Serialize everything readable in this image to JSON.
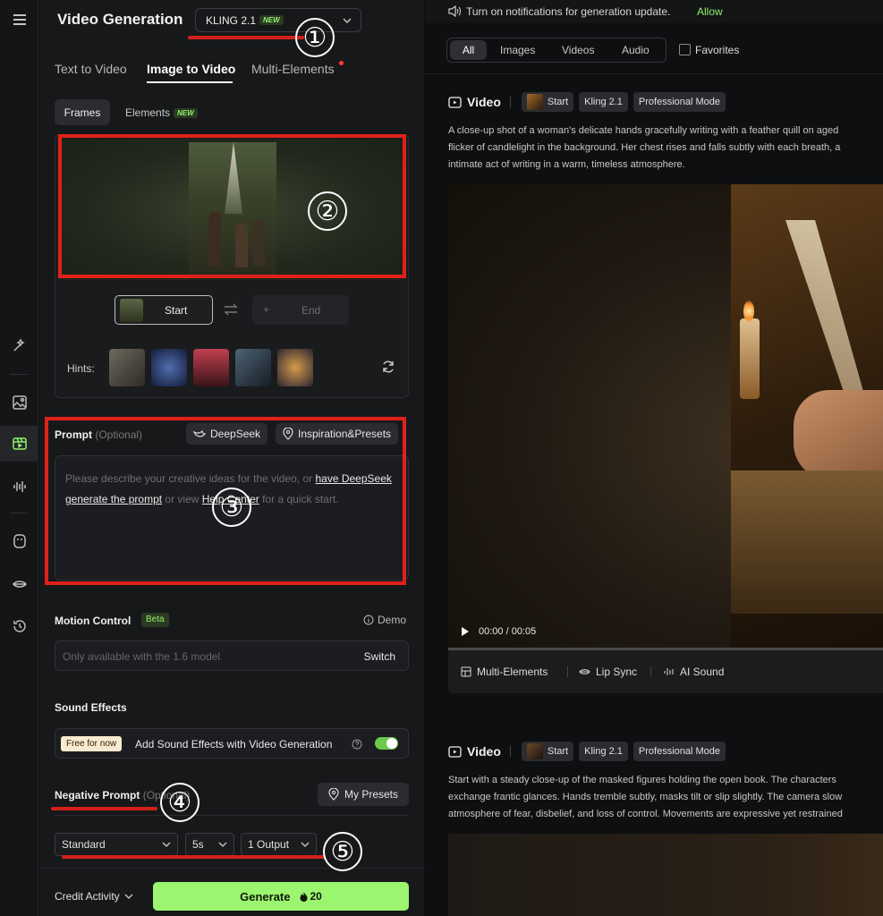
{
  "rail": {
    "icons": [
      "magic-icon",
      "image-icon",
      "video-icon",
      "audio-icon",
      "avatar-icon",
      "lip-icon",
      "history-icon"
    ]
  },
  "header": {
    "title": "Video Generation",
    "model": "KLING 2.1",
    "model_badge": "NEW"
  },
  "tabs": [
    {
      "label": "Text to Video"
    },
    {
      "label": "Image to Video"
    },
    {
      "label": "Multi-Elements"
    }
  ],
  "subtabs": {
    "frames": "Frames",
    "elements": "Elements",
    "elements_badge": "NEW"
  },
  "frames": {
    "start": "Start",
    "end": "End",
    "end_plus": "+"
  },
  "hints": {
    "label": "Hints:"
  },
  "prompt": {
    "label": "Prompt",
    "optional": "(Optional)",
    "deepseek": "DeepSeek",
    "inspiration": "Inspiration&Presets",
    "ph_1": "Please describe your creative ideas for the video, or ",
    "ph_link1": "have DeepSeek generate the prompt",
    "ph_2": " or view ",
    "ph_link2": "Help Center",
    "ph_3": " for a quick start."
  },
  "motion": {
    "label": "Motion Control",
    "badge": "Beta",
    "demo": "Demo",
    "placeholder": "Only available with the 1.6 model",
    "switch": "Switch"
  },
  "sound": {
    "label": "Sound Effects",
    "free": "Free for now",
    "text": "Add Sound Effects with Video Generation",
    "toggle_on": true
  },
  "negative": {
    "label": "Negative Prompt",
    "optional": "(Optional)",
    "presets": "My Presets"
  },
  "settings": {
    "mode": "Standard",
    "duration": "5s",
    "outputs": "1 Output"
  },
  "footer": {
    "credit": "Credit Activity",
    "generate": "Generate",
    "cost": "20"
  },
  "annotations": [
    "①",
    "②",
    "③",
    "④",
    "⑤"
  ],
  "feed": {
    "notice": "Turn on notifications for generation update.",
    "allow": "Allow",
    "filters": [
      "All",
      "Images",
      "Videos",
      "Audio"
    ],
    "favorites": "Favorites",
    "cards": [
      {
        "type": "Video",
        "start": "Start",
        "model": "Kling 2.1",
        "mode": "Professional Mode",
        "lines": [
          "A close-up shot of a woman's delicate hands gracefully writing with a feather quill on aged",
          "flicker of candlelight in the background. Her chest rises and falls subtly with each breath, a",
          "intimate act of writing in a warm, timeless atmosphere."
        ],
        "time": "00:00 / 00:05",
        "actions": [
          "Multi-Elements",
          "Lip Sync",
          "AI Sound"
        ]
      },
      {
        "type": "Video",
        "start": "Start",
        "model": "Kling 2.1",
        "mode": "Professional Mode",
        "lines": [
          "Start with a steady close-up of the masked figures holding the open book. The characters",
          "exchange frantic glances. Hands tremble subtly, masks tilt or slip slightly. The camera slow",
          "atmosphere of fear, disbelief, and loss of control. Movements are expressive yet restrained"
        ]
      }
    ]
  },
  "colors": {
    "accent": "#8ef26b",
    "annotation_red": "#e0211a",
    "generate_bg": "#9bf56f"
  }
}
